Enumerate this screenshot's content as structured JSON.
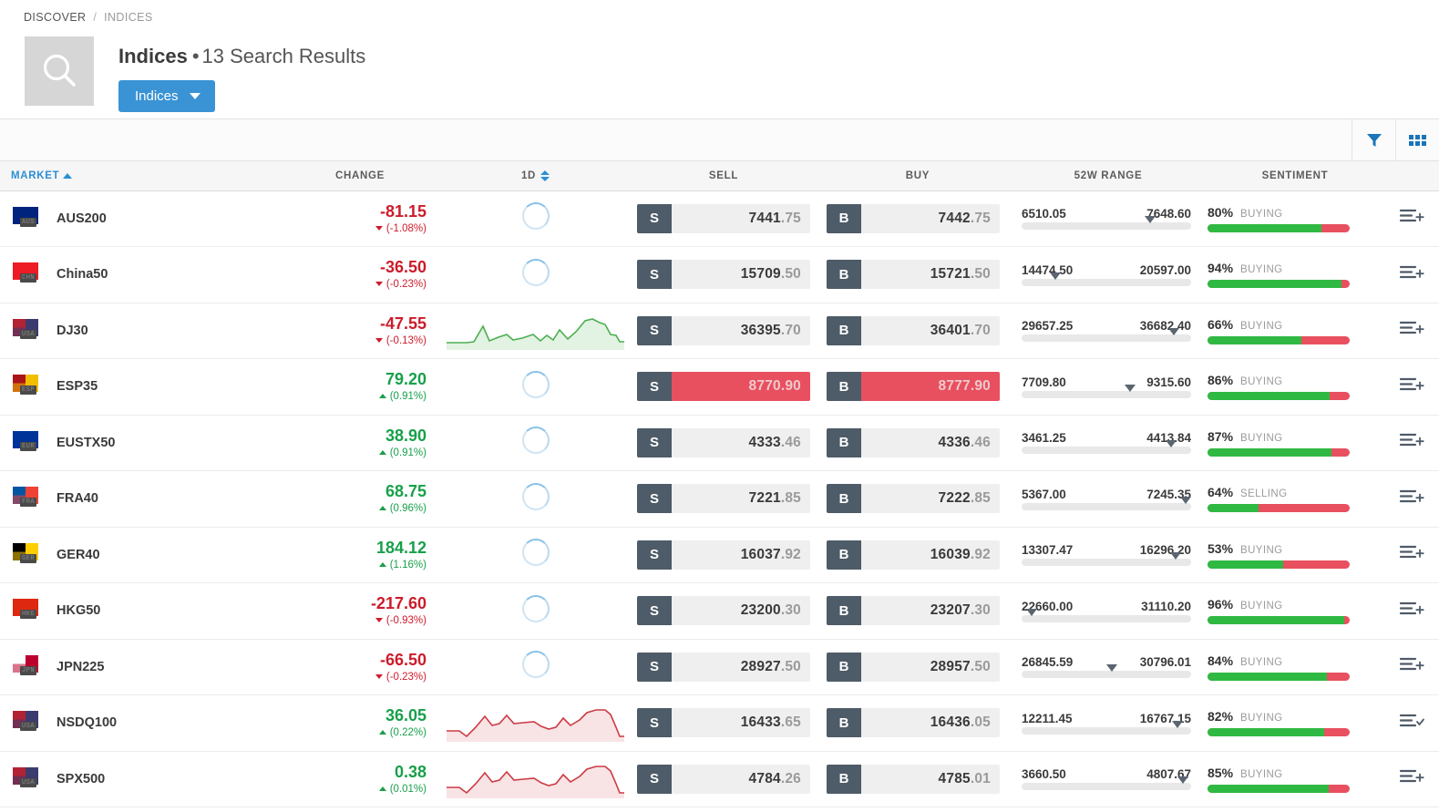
{
  "breadcrumb": {
    "root": "DISCOVER",
    "sep": "/",
    "current": "INDICES"
  },
  "header": {
    "title": "Indices",
    "bullet": "•",
    "results": "13 Search Results",
    "dropdown_label": "Indices",
    "search_icon": "search-icon"
  },
  "toolbar": {
    "filter_icon": "filter-icon",
    "grid_icon": "grid-view-icon"
  },
  "columns": {
    "market": "MARKET",
    "change": "CHANGE",
    "period": "1D",
    "sell": "SELL",
    "buy": "BUY",
    "range": "52W RANGE",
    "sentiment": "SENTIMENT"
  },
  "colors": {
    "accent": "#3a93d4",
    "link": "#2b8fd4",
    "up": "#18a04a",
    "down": "#cc1c2c",
    "alert": "#e8505f",
    "tag": "#4e5b68",
    "sent_green": "#2fb943",
    "sent_red": "#e8505f"
  },
  "sell_tag": "S",
  "buy_tag": "B",
  "rows": [
    {
      "symbol": "AUS200",
      "flag_code": "AUS",
      "flag_colors": [
        "#00247d",
        "#00247d"
      ],
      "change": "-81.15",
      "change_pct": "(-1.08%)",
      "dir": "down",
      "spark": null,
      "sell": "7441.75",
      "buy": "7442.75",
      "alert": false,
      "range_low": "6510.05",
      "range_high": "7648.60",
      "range_pos": 76,
      "sent_pct": "80%",
      "sent_label": "BUYING",
      "sent_green": 80,
      "watchlist": "add"
    },
    {
      "symbol": "China50",
      "flag_code": "CHN",
      "flag_colors": [
        "#ee1c25",
        "#ee1c25"
      ],
      "change": "-36.50",
      "change_pct": "(-0.23%)",
      "dir": "down",
      "spark": null,
      "sell": "15709.50",
      "buy": "15721.50",
      "alert": false,
      "range_low": "14474.50",
      "range_high": "20597.00",
      "range_pos": 20,
      "sent_pct": "94%",
      "sent_label": "BUYING",
      "sent_green": 94,
      "watchlist": "add"
    },
    {
      "symbol": "DJ30",
      "flag_code": "USA",
      "flag_colors": [
        "#b22234",
        "#3c3b6e"
      ],
      "change": "-47.55",
      "change_pct": "(-0.13%)",
      "dir": "down",
      "spark": "up",
      "sell": "36395.70",
      "buy": "36401.70",
      "alert": false,
      "range_low": "29657.25",
      "range_high": "36682.40",
      "range_pos": 90,
      "sent_pct": "66%",
      "sent_label": "BUYING",
      "sent_green": 66,
      "watchlist": "add"
    },
    {
      "symbol": "ESP35",
      "flag_code": "ESP",
      "flag_colors": [
        "#aa151b",
        "#f1bf00"
      ],
      "change": "79.20",
      "change_pct": "(0.91%)",
      "dir": "up",
      "spark": null,
      "sell": "8770.90",
      "buy": "8777.90",
      "alert": true,
      "range_low": "7709.80",
      "range_high": "9315.60",
      "range_pos": 64,
      "sent_pct": "86%",
      "sent_label": "BUYING",
      "sent_green": 86,
      "watchlist": "add"
    },
    {
      "symbol": "EUSTX50",
      "flag_code": "EUR",
      "flag_colors": [
        "#003399",
        "#003399"
      ],
      "change": "38.90",
      "change_pct": "(0.91%)",
      "dir": "up",
      "spark": null,
      "sell": "4333.46",
      "buy": "4336.46",
      "alert": false,
      "range_low": "3461.25",
      "range_high": "4413.84",
      "range_pos": 88,
      "sent_pct": "87%",
      "sent_label": "BUYING",
      "sent_green": 87,
      "watchlist": "add"
    },
    {
      "symbol": "FRA40",
      "flag_code": "FRA",
      "flag_colors": [
        "#0055a4",
        "#ef4135"
      ],
      "change": "68.75",
      "change_pct": "(0.96%)",
      "dir": "up",
      "spark": null,
      "sell": "7221.85",
      "buy": "7222.85",
      "alert": false,
      "range_low": "5367.00",
      "range_high": "7245.35",
      "range_pos": 97,
      "sent_pct": "64%",
      "sent_label": "SELLING",
      "sent_green": 36,
      "watchlist": "add"
    },
    {
      "symbol": "GER40",
      "flag_code": "GER",
      "flag_colors": [
        "#000000",
        "#ffce00"
      ],
      "change": "184.12",
      "change_pct": "(1.16%)",
      "dir": "up",
      "spark": null,
      "sell": "16037.92",
      "buy": "16039.92",
      "alert": false,
      "range_low": "13307.47",
      "range_high": "16296.20",
      "range_pos": 91,
      "sent_pct": "53%",
      "sent_label": "BUYING",
      "sent_green": 53,
      "watchlist": "add"
    },
    {
      "symbol": "HKG50",
      "flag_code": "HKG",
      "flag_colors": [
        "#de2910",
        "#de2910"
      ],
      "change": "-217.60",
      "change_pct": "(-0.93%)",
      "dir": "down",
      "spark": null,
      "sell": "23200.30",
      "buy": "23207.30",
      "alert": false,
      "range_low": "22660.00",
      "range_high": "31110.20",
      "range_pos": 6,
      "sent_pct": "96%",
      "sent_label": "BUYING",
      "sent_green": 96,
      "watchlist": "add"
    },
    {
      "symbol": "JPN225",
      "flag_code": "JPN",
      "flag_colors": [
        "#ffffff",
        "#bc002d"
      ],
      "change": "-66.50",
      "change_pct": "(-0.23%)",
      "dir": "down",
      "spark": null,
      "sell": "28927.50",
      "buy": "28957.50",
      "alert": false,
      "range_low": "26845.59",
      "range_high": "30796.01",
      "range_pos": 53,
      "sent_pct": "84%",
      "sent_label": "BUYING",
      "sent_green": 84,
      "watchlist": "add"
    },
    {
      "symbol": "NSDQ100",
      "flag_code": "USA",
      "flag_colors": [
        "#b22234",
        "#3c3b6e"
      ],
      "change": "36.05",
      "change_pct": "(0.22%)",
      "dir": "up",
      "spark": "down",
      "sell": "16433.65",
      "buy": "16436.05",
      "alert": false,
      "range_low": "12211.45",
      "range_high": "16767.15",
      "range_pos": 92,
      "sent_pct": "82%",
      "sent_label": "BUYING",
      "sent_green": 82,
      "watchlist": "added"
    },
    {
      "symbol": "SPX500",
      "flag_code": "USA",
      "flag_colors": [
        "#b22234",
        "#3c3b6e"
      ],
      "change": "0.38",
      "change_pct": "(0.01%)",
      "dir": "up",
      "spark": "down",
      "sell": "4784.26",
      "buy": "4785.01",
      "alert": false,
      "range_low": "3660.50",
      "range_high": "4807.67",
      "range_pos": 95,
      "sent_pct": "85%",
      "sent_label": "BUYING",
      "sent_green": 85,
      "watchlist": "add"
    }
  ]
}
